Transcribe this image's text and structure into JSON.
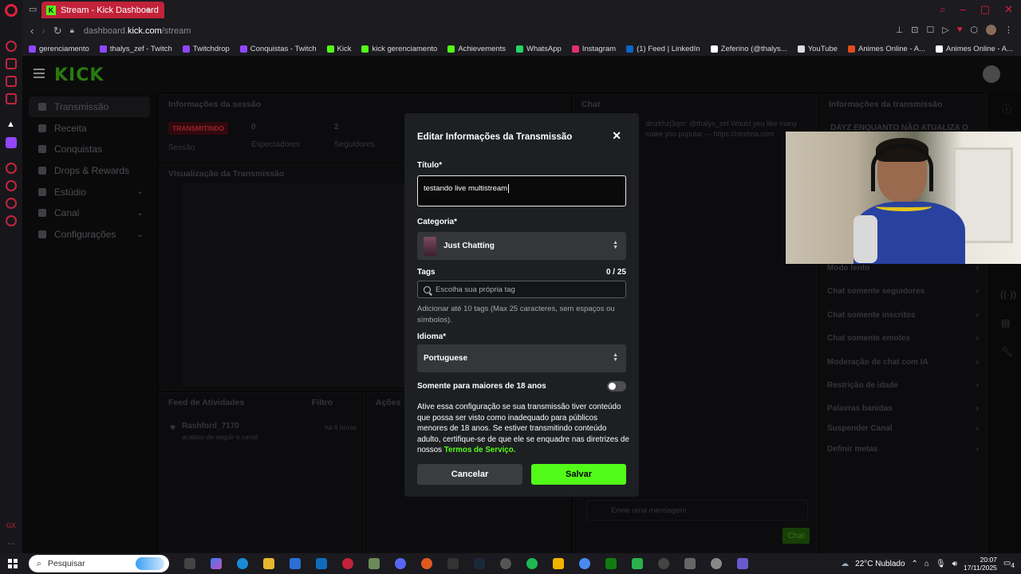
{
  "browser": {
    "tab_title": "Stream - Kick Dashboard",
    "url_domain": "dashboard.",
    "url_bold": "kick.com",
    "url_path": "/stream",
    "bookmarks": [
      {
        "label": "gerenciamento",
        "color": "#9146ff"
      },
      {
        "label": "thalys_zef - Twitch",
        "color": "#9146ff"
      },
      {
        "label": "Twitchdrop",
        "color": "#9146ff"
      },
      {
        "label": "Conquistas - Twitch",
        "color": "#9146ff"
      },
      {
        "label": "Kick",
        "color": "#53fc18"
      },
      {
        "label": "kick gerenciamento",
        "color": "#53fc18"
      },
      {
        "label": "Achievements",
        "color": "#53fc18"
      },
      {
        "label": "WhatsApp",
        "color": "#25d366"
      },
      {
        "label": "Instagram",
        "color": "#e1306c"
      },
      {
        "label": "(1) Feed | LinkedIn",
        "color": "#0a66c2"
      },
      {
        "label": "Zeferino (@thalys...",
        "color": "#ffffff"
      },
      {
        "label": "YouTube",
        "color": "#dddddd"
      },
      {
        "label": "Animes Online - A...",
        "color": "#e04a1f"
      },
      {
        "label": "Animes Online - A...",
        "color": "#ffffff"
      }
    ]
  },
  "sidebar": {
    "items": [
      {
        "label": "Transmissão",
        "active": true
      },
      {
        "label": "Receita"
      },
      {
        "label": "Conquistas"
      },
      {
        "label": "Drops & Rewards"
      },
      {
        "label": "Estúdio",
        "chevron": true
      },
      {
        "label": "Canal",
        "chevron": true
      },
      {
        "label": "Configurações",
        "chevron": true
      }
    ]
  },
  "session": {
    "title": "Informações da sessão",
    "live_badge": "TRANSMITINDO",
    "session_label": "Sessão",
    "viewers_value": "0",
    "viewers_label": "Espectadores",
    "followers_value": "2",
    "followers_label": "Seguidores"
  },
  "preview": {
    "title": "Visualização da Transmissão"
  },
  "activity": {
    "title": "Feed de Atividades",
    "filter": "Filtro",
    "user": "Rashford_7170",
    "time": "há 6 horas",
    "event": "acabou de seguir o canal"
  },
  "actions": {
    "title": "Ações"
  },
  "chat": {
    "title": "Chat",
    "message_user": "dinzkhzj3qm:",
    "message_mention": "@thalys_zef",
    "message_text": "Would you like many",
    "message_text2": "make you popular — https://nezhna.com",
    "input_placeholder": "Envie uma mensagem",
    "send_label": "Chat"
  },
  "stream_info": {
    "title": "Informações da transmissão",
    "stream_title_preview": "DAYZ ENQUANTO NÃO ATUALIZA O",
    "options": [
      "Modo lento",
      "Chat somente seguidores",
      "Chat somente inscritos",
      "Chat somente emotes",
      "Moderação de chat com IA",
      "Restrição de idade",
      "Palavras banidas",
      "Suspender Canal",
      "Definir metas"
    ]
  },
  "modal": {
    "title": "Editar Informações da Transmissão",
    "title_label": "Título*",
    "title_value": "testando live multistream",
    "category_label": "Categoria*",
    "category_value": "Just Chatting",
    "tags_label": "Tags",
    "tags_count": "0 / 25",
    "tags_placeholder": "Escolha sua própria tag",
    "tags_help": "Adicionar até 10 tags (Max 25 caracteres, sem espaços ou símbolos).",
    "language_label": "Idioma*",
    "language_value": "Portuguese",
    "adult_label": "Somente para maiores de 18 anos",
    "adult_help": "Ative essa configuração se sua transmissão tiver conteúdo que possa ser visto como inadequado para públicos menores de 18 anos. Se estiver transmitindo conteúdo adulto, certifique-se de que ele se enquadre nas diretrizes de nossos",
    "tos_link": "Termos de Serviço",
    "tos_suffix": ".",
    "cancel_label": "Cancelar",
    "save_label": "Salvar"
  },
  "taskbar": {
    "search_placeholder": "Pesquisar",
    "weather": "22°C  Nublado",
    "time": "20:07",
    "date": "17/11/2025",
    "notifications": "4"
  },
  "colors": {
    "kick_green": "#53fc18",
    "opera_red": "#e0213b",
    "modal_bg": "#1d1f22"
  }
}
